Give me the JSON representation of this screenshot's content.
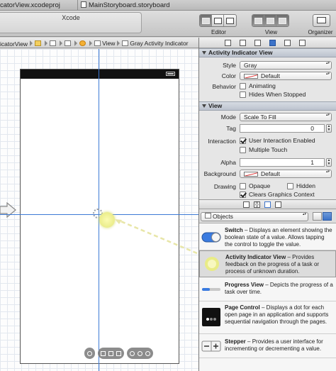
{
  "tabs": [
    {
      "label": "catorView.xcodeproj"
    },
    {
      "label": "MainStoryboard.storyboard"
    }
  ],
  "toolbar": {
    "window_title": "Xcode",
    "editor_label": "Editor",
    "view_label": "View",
    "organizer_label": "Organizer"
  },
  "jumpbar": {
    "first": "icatorView",
    "view": "View",
    "indicator": "Gray Activity Indicator"
  },
  "inspector": {
    "activity_section": {
      "title": "Activity Indicator View",
      "style_label": "Style",
      "style_value": "Gray",
      "color_label": "Color",
      "color_value": "Default",
      "behavior_label": "Behavior",
      "animating_label": "Animating",
      "animating_checked": false,
      "hides_label": "Hides When Stopped",
      "hides_checked": false
    },
    "view_section": {
      "title": "View",
      "mode_label": "Mode",
      "mode_value": "Scale To Fill",
      "tag_label": "Tag",
      "tag_value": "0",
      "interaction_label": "Interaction",
      "user_interaction_label": "User Interaction Enabled",
      "user_interaction_checked": true,
      "multiple_touch_label": "Multiple Touch",
      "multiple_touch_checked": false,
      "alpha_label": "Alpha",
      "alpha_value": "1",
      "background_label": "Background",
      "background_value": "Default",
      "drawing_label": "Drawing",
      "opaque_label": "Opaque",
      "opaque_checked": false,
      "hidden_label": "Hidden",
      "hidden_checked": false,
      "clears_label": "Clears Graphics Context",
      "clears_checked": true
    }
  },
  "library": {
    "filter_value": "Objects",
    "items": [
      {
        "title": "Switch",
        "description": " – Displays an element showing the boolean state of a value. Allows tapping the control to toggle the value."
      },
      {
        "title": "Activity Indicator View",
        "description": " – Provides feedback on the progress of a task or process of unknown duration."
      },
      {
        "title": "Progress View",
        "description": " – Depicts the progress of a task over time."
      },
      {
        "title": "Page Control",
        "description": " – Displays a dot for each open page in an application and supports sequential navigation through the pages."
      },
      {
        "title": "Stepper",
        "description": " – Provides a user interface for incrementing or decrementing a value."
      }
    ]
  },
  "colors": {
    "guide": "#3d7ad6",
    "selection": "#3c73c9",
    "drag_blob": "#e3e67a"
  }
}
